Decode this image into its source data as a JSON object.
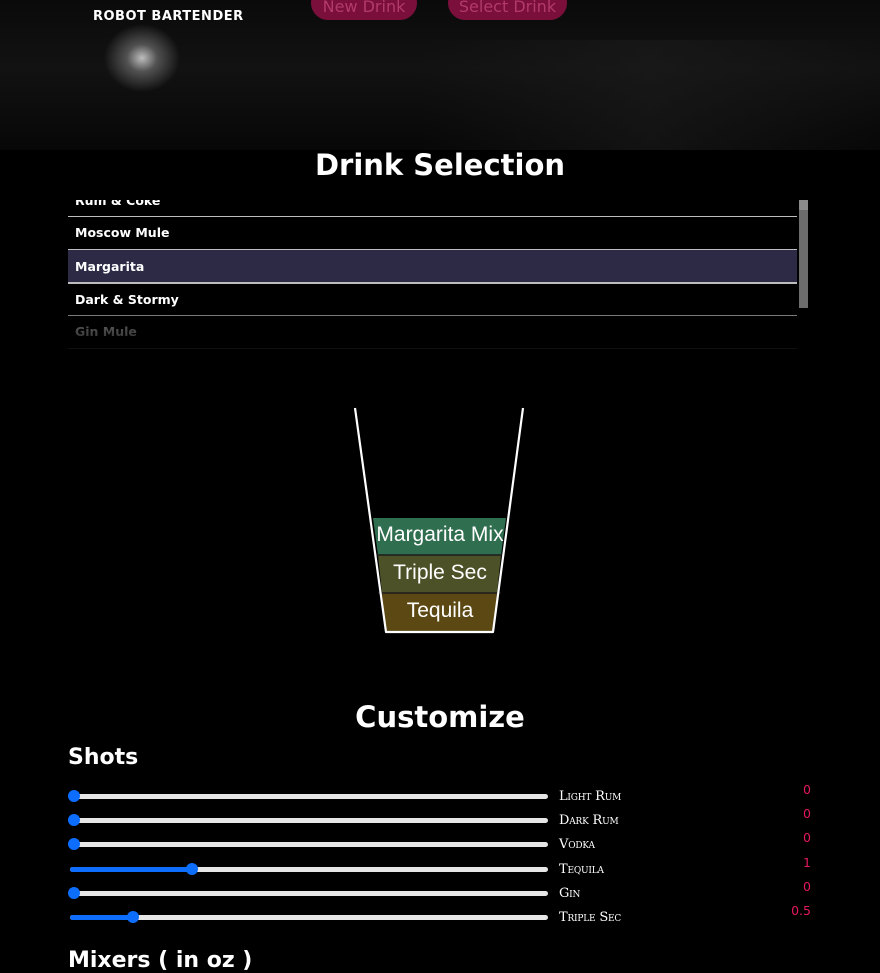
{
  "header": {
    "brand": "ROBOT BARTENDER",
    "new_drink_label": "New Drink",
    "select_drink_label": "Select Drink"
  },
  "selection": {
    "title": "Drink Selection",
    "drinks": [
      {
        "name": "Rum & Coke"
      },
      {
        "name": "Moscow Mule"
      },
      {
        "name": "Margarita",
        "selected": true
      },
      {
        "name": "Dark & Stormy"
      },
      {
        "name": "Gin Mule"
      }
    ]
  },
  "glass": {
    "layers": [
      {
        "name": "Margarita Mix",
        "color": "#2f6e4f"
      },
      {
        "name": "Triple Sec",
        "color": "#4c5127"
      },
      {
        "name": "Tequila",
        "color": "#5c4813"
      }
    ]
  },
  "customize": {
    "title": "Customize",
    "shots_title": "Shots",
    "mixers_title": "Mixers ( in oz )",
    "slider_max": 4,
    "shots": [
      {
        "name": "Light Rum",
        "value": 0,
        "display": "0"
      },
      {
        "name": "Dark Rum",
        "value": 0,
        "display": "0"
      },
      {
        "name": "Vodka",
        "value": 0,
        "display": "0"
      },
      {
        "name": "Tequila",
        "value": 1,
        "display": "1"
      },
      {
        "name": "Gin",
        "value": 0,
        "display": "0"
      },
      {
        "name": "Triple Sec",
        "value": 0.5,
        "display": "0.5"
      }
    ]
  },
  "colors": {
    "accent": "#0d6efd",
    "value_text": "#e3195b",
    "button_bg": "#7a0f3c",
    "selected_row": "#2d2a45"
  }
}
